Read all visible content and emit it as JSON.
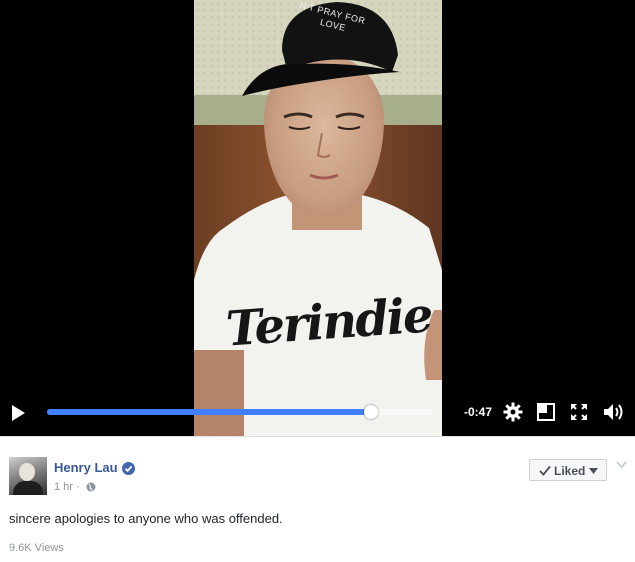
{
  "player": {
    "progress_fraction": 0.84,
    "time_remaining": "-0:47",
    "accent_color": "#4080ff",
    "cap_text_line1": "N'T PRAY FOR",
    "cap_text_line2": "LOVE",
    "shirt_print": "Terindie",
    "icons": [
      "play-icon",
      "gear-icon",
      "popout-icon",
      "fullscreen-icon",
      "volume-icon"
    ]
  },
  "post": {
    "author": "Henry Lau",
    "timestamp": "1 hr ·",
    "liked_label": "Liked",
    "message": "sincere apologies to anyone who was offended.",
    "views": "9.6K Views",
    "author_color": "#365899"
  }
}
